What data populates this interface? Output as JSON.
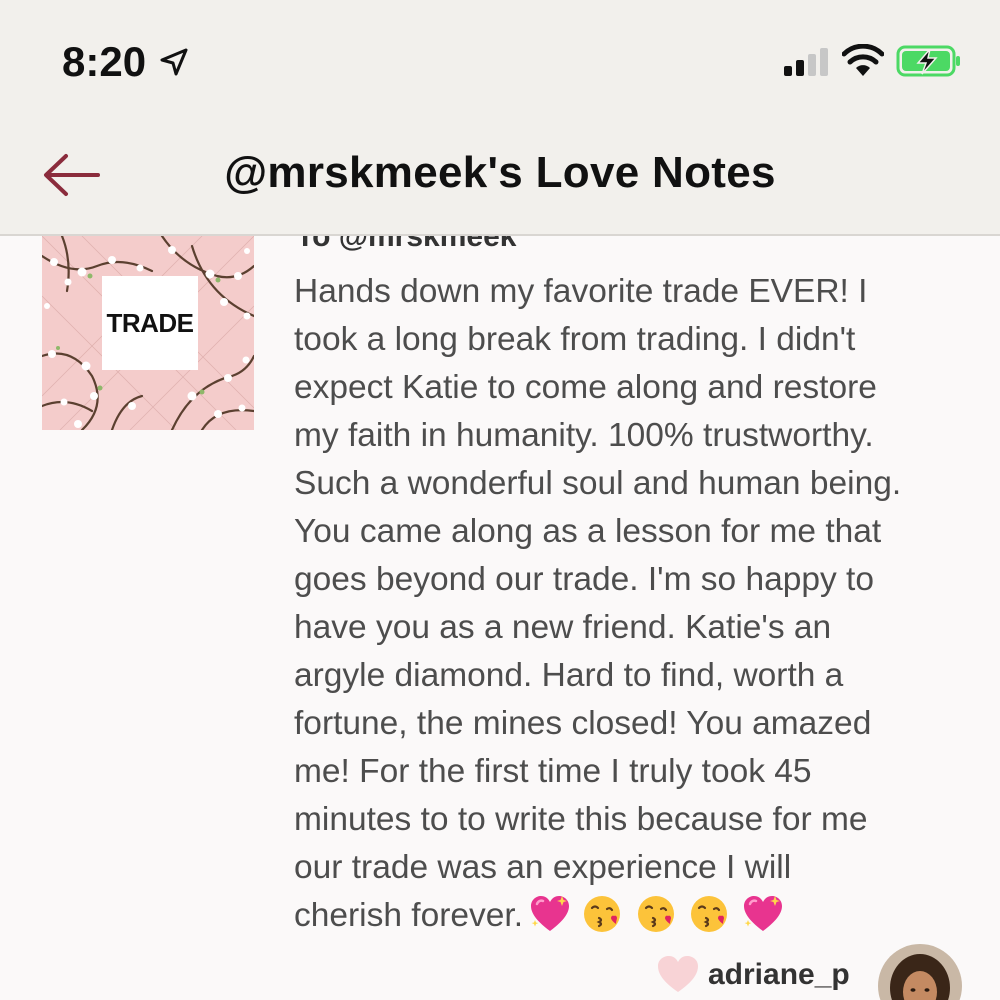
{
  "status_bar": {
    "time": "8:20",
    "icons": [
      "location-arrow-icon",
      "cellular-signal-icon",
      "wifi-icon",
      "battery-charging-icon"
    ]
  },
  "nav": {
    "back_icon": "back-arrow-icon",
    "title": "@mrskmeek's Love Notes"
  },
  "note": {
    "image_label": "TRADE",
    "to": "To @mrskmeek",
    "lines": [
      "Hands down my favorite trade EVER! I",
      "took a long break from trading. I didn't",
      "expect Katie to come along and restore",
      "my faith in humanity. 100% trustworthy.",
      "Such a wonderful soul and human being.",
      "You came along as a lesson for me that",
      "goes beyond our trade. I'm so happy to",
      "have you as a new friend. Katie's an",
      "argyle diamond. Hard to find, worth a",
      "fortune, the mines closed! You amazed",
      "me! For the first time I truly took 45",
      "minutes to to write this because for me",
      "our trade was an experience I will",
      "cherish forever."
    ],
    "emojis": [
      "sparkling-heart-icon",
      "face-blowing-kiss-icon",
      "face-blowing-kiss-icon",
      "face-blowing-kiss-icon",
      "sparkling-heart-icon"
    ],
    "author": "adriane_p",
    "like_icon": "heart-icon"
  },
  "colors": {
    "header_bg": "#f2f0ec",
    "accent": "#8b2c3c",
    "battery_green": "#4cd964",
    "body_text": "#4d4d4d"
  }
}
